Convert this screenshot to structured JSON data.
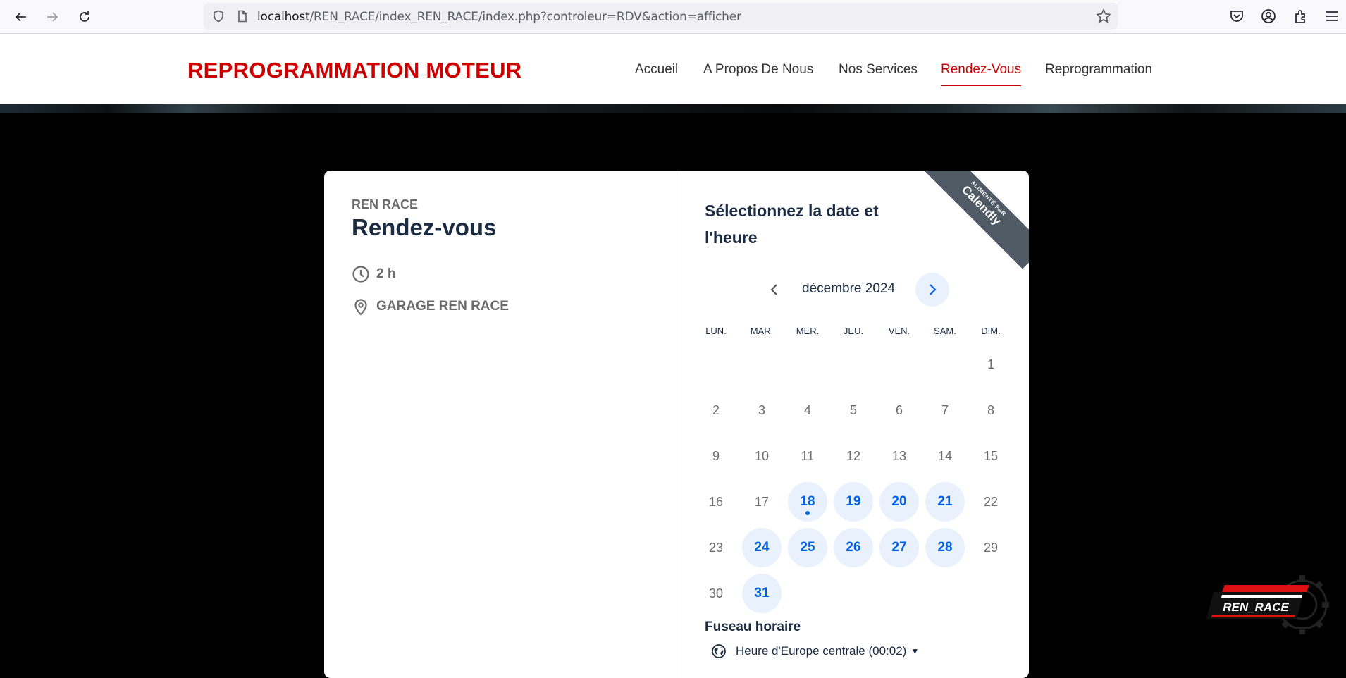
{
  "browser": {
    "url_host": "localhost",
    "url_path": "/REN_RACE/index_REN_RACE/index.php?controleur=RDV&action=afficher"
  },
  "site": {
    "brand": "REPROGRAMMATION MOTEUR",
    "nav": [
      {
        "label": "Accueil",
        "active": false
      },
      {
        "label": "A Propos De Nous",
        "active": false
      },
      {
        "label": "Nos Services",
        "active": false
      },
      {
        "label": "Rendez-Vous",
        "active": true
      },
      {
        "label": "Reprogrammation",
        "active": false
      }
    ],
    "accent_color": "#cc0000"
  },
  "event": {
    "organizer": "REN RACE",
    "title": "Rendez-vous",
    "duration": "2 h",
    "location": "GARAGE REN RACE"
  },
  "scheduler": {
    "title": "Sélectionnez la date et l'heure",
    "powered_by_small": "ALIMENTÉ PAR",
    "powered_by_brand": "Calendly",
    "month_label": "décembre 2024",
    "weekdays": [
      "LUN.",
      "MAR.",
      "MER.",
      "JEU.",
      "VEN.",
      "SAM.",
      "DIM."
    ],
    "weeks": [
      [
        null,
        null,
        null,
        null,
        null,
        null,
        {
          "d": "1"
        }
      ],
      [
        {
          "d": "2"
        },
        {
          "d": "3"
        },
        {
          "d": "4"
        },
        {
          "d": "5"
        },
        {
          "d": "6"
        },
        {
          "d": "7"
        },
        {
          "d": "8"
        }
      ],
      [
        {
          "d": "9"
        },
        {
          "d": "10"
        },
        {
          "d": "11"
        },
        {
          "d": "12"
        },
        {
          "d": "13"
        },
        {
          "d": "14"
        },
        {
          "d": "15"
        }
      ],
      [
        {
          "d": "16"
        },
        {
          "d": "17"
        },
        {
          "d": "18",
          "avail": true,
          "today": true
        },
        {
          "d": "19",
          "avail": true
        },
        {
          "d": "20",
          "avail": true
        },
        {
          "d": "21",
          "avail": true
        },
        {
          "d": "22"
        }
      ],
      [
        {
          "d": "23"
        },
        {
          "d": "24",
          "avail": true
        },
        {
          "d": "25",
          "avail": true
        },
        {
          "d": "26",
          "avail": true
        },
        {
          "d": "27",
          "avail": true
        },
        {
          "d": "28",
          "avail": true
        },
        {
          "d": "29"
        }
      ],
      [
        {
          "d": "30"
        },
        {
          "d": "31",
          "avail": true
        },
        null,
        null,
        null,
        null,
        null
      ]
    ],
    "timezone_label": "Fuseau horaire",
    "timezone_value": "Heure d'Europe centrale (00:02)",
    "accent_color": "#0060e6"
  },
  "badge": {
    "text": "REN_RACE"
  }
}
